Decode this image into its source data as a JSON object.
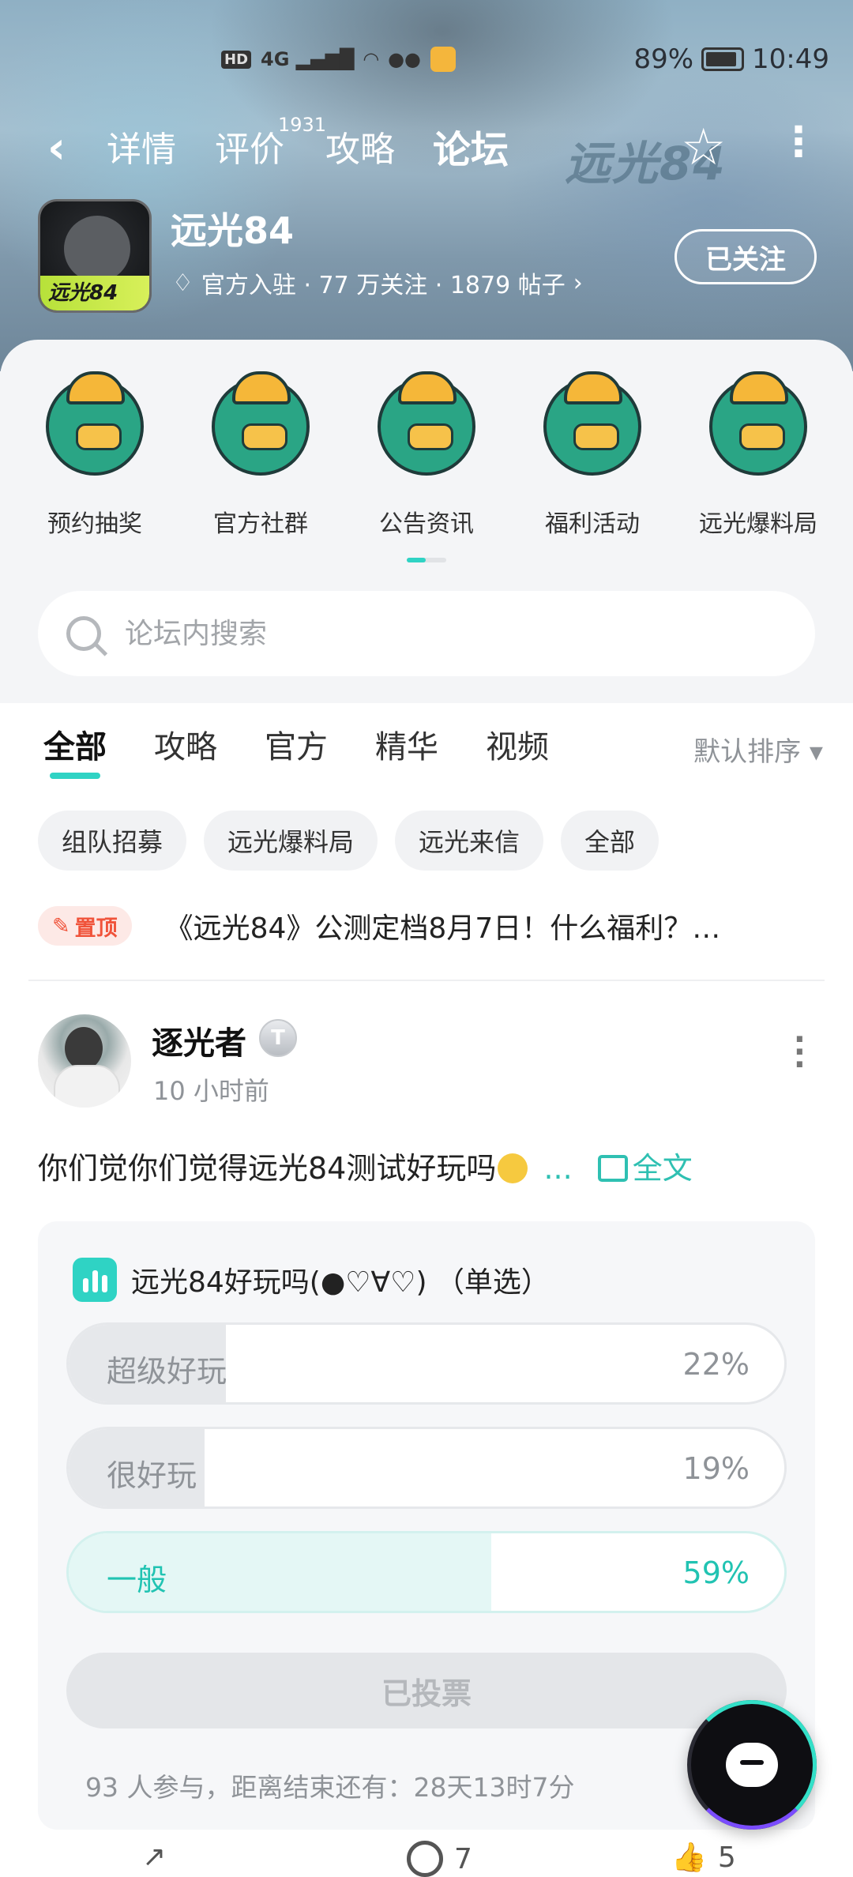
{
  "status_bar": {
    "hd": "HD",
    "network": "4G",
    "battery": "89%",
    "time": "10:49"
  },
  "nav": {
    "tabs": [
      {
        "label": "详情"
      },
      {
        "label": "评价",
        "count": "1931"
      },
      {
        "label": "攻略"
      },
      {
        "label": "论坛",
        "active": true
      }
    ],
    "logo_text": "远光84"
  },
  "game": {
    "icon_text": "远光84",
    "name": "远光84",
    "meta": "官方入驻 · 77 万关注 · 1879 帖子",
    "follow_label": "已关注"
  },
  "categories": [
    {
      "label": "预约抽奖"
    },
    {
      "label": "官方社群"
    },
    {
      "label": "公告资讯"
    },
    {
      "label": "福利活动"
    },
    {
      "label": "远光爆料局"
    }
  ],
  "search": {
    "placeholder": "论坛内搜索"
  },
  "feed": {
    "tabs": [
      "全部",
      "攻略",
      "官方",
      "精华",
      "视频"
    ],
    "sort_label": "默认排序",
    "chips": [
      "组队招募",
      "远光爆料局",
      "远光来信",
      "全部"
    ],
    "pinned": {
      "badge": "置顶",
      "title": "《远光84》公测定档8月7日！什么福利？…"
    }
  },
  "post": {
    "author": "逐光者",
    "level": "T",
    "time": "10 小时前",
    "text": "你们觉你们觉得远光84测试好玩吗",
    "ellipsis": "...",
    "full_text_label": "全文",
    "poll": {
      "title": "远光84好玩吗(●♡∀♡) （单选）",
      "options": [
        {
          "label": "超级好玩",
          "pct": "22%",
          "value": 22
        },
        {
          "label": "很好玩",
          "pct": "19%",
          "value": 19
        },
        {
          "label": "一般",
          "pct": "59%",
          "value": 59,
          "selected": true
        }
      ],
      "voted_label": "已投票",
      "footer": "93 人参与，距离结束还有：28天13时7分"
    },
    "actions": {
      "comments": "7",
      "likes": "5"
    }
  },
  "colors": {
    "accent": "#2fd3c4",
    "pinned": "#f0533a"
  }
}
